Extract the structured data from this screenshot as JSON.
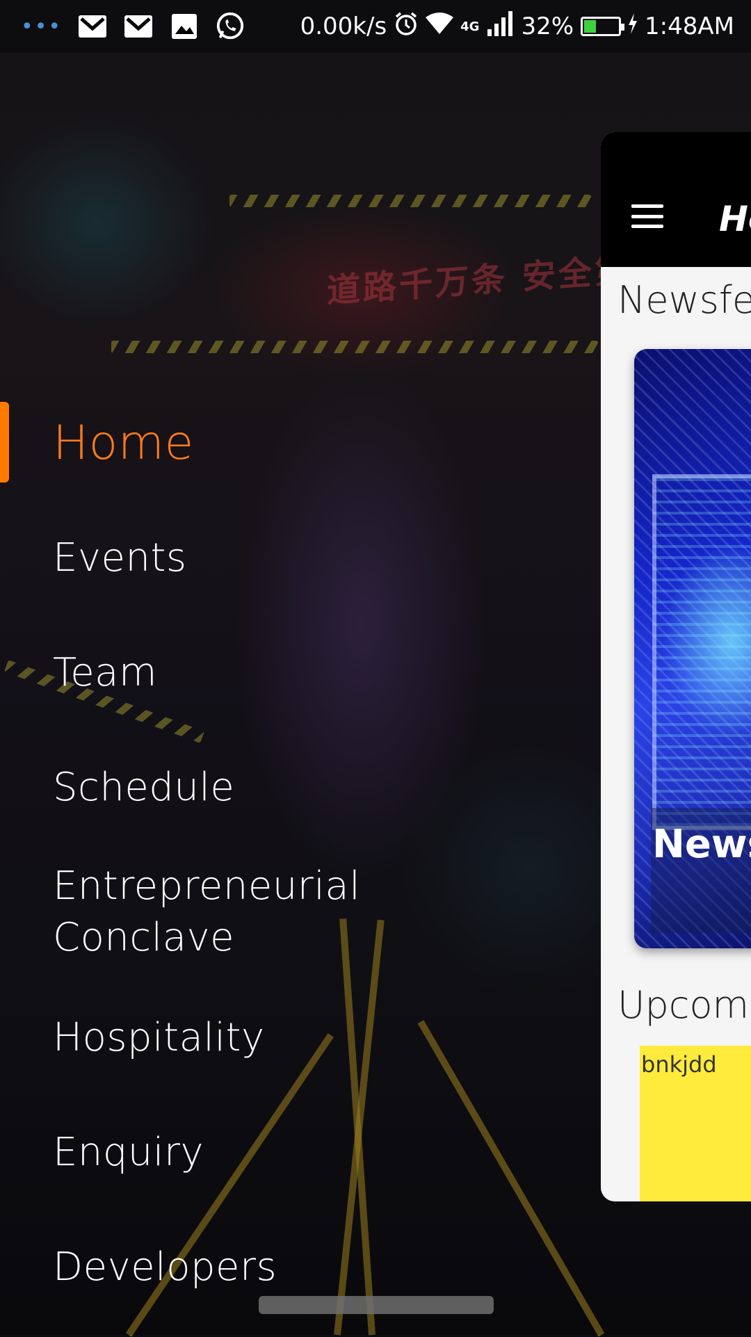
{
  "status_bar": {
    "net_speed": "0.00k/s",
    "network_type": "4G",
    "battery_percent": "32%",
    "battery_level": 0.32,
    "time": "1:48AM",
    "icons": [
      "more-dots-icon",
      "gmail-icon",
      "gmail-icon",
      "gallery-icon",
      "whatsapp-icon",
      "alarm-icon",
      "wifi-icon",
      "signal-icon",
      "battery-icon",
      "charging-icon"
    ]
  },
  "drawer": {
    "items": [
      {
        "label": "Home",
        "active": true
      },
      {
        "label": "Events"
      },
      {
        "label": "Team"
      },
      {
        "label": "Schedule"
      },
      {
        "label": "Entrepreneurial"
      },
      {
        "label": "Conclave"
      },
      {
        "label": "Hospitality"
      },
      {
        "label": "Enquiry"
      },
      {
        "label": "Developers"
      }
    ],
    "accent_color": "#ff7a00"
  },
  "main": {
    "toolbar_title": "Ho",
    "newsfeed_heading": "Newsfe",
    "news_card_title": "News",
    "upcoming_heading": "Upcom",
    "event_card_text": "bnkjdd",
    "event_card_color": "#ffeb3b"
  }
}
